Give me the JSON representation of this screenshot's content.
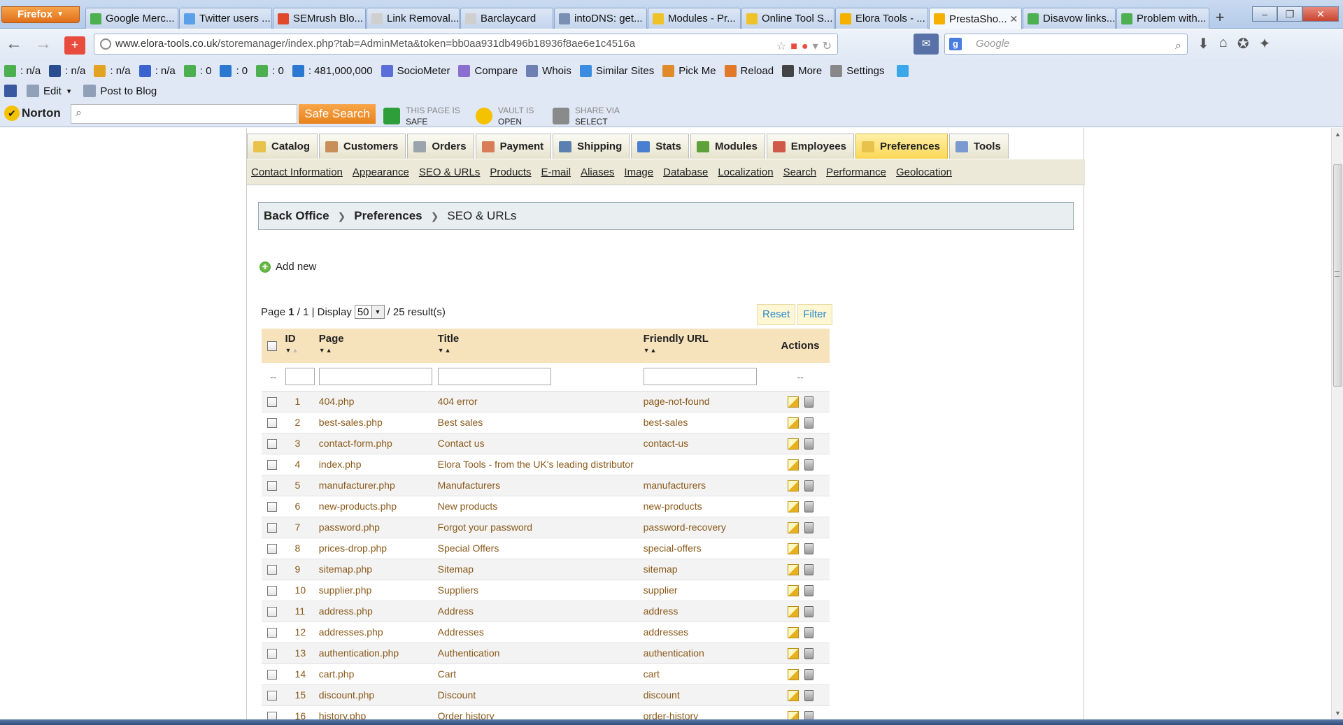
{
  "browser": {
    "app_button": "Firefox",
    "tabs": [
      {
        "label": "Google Merc...",
        "color": "#4caf50"
      },
      {
        "label": "Twitter users ...",
        "color": "#5aa0e8"
      },
      {
        "label": "SEMrush Blo...",
        "color": "#e04a2a"
      },
      {
        "label": "Link Removal...",
        "color": "#cfcfcf"
      },
      {
        "label": "Barclaycard",
        "color": "#cfcfcf"
      },
      {
        "label": "intoDNS: get...",
        "color": "#7a8fb4"
      },
      {
        "label": "Modules - Pr...",
        "color": "#f0c22a"
      },
      {
        "label": "Online Tool S...",
        "color": "#f0c22a"
      },
      {
        "label": "Elora Tools - ...",
        "color": "#f5b000"
      },
      {
        "label": "PrestaSho...",
        "color": "#f5b000",
        "active": true
      },
      {
        "label": "Disavow links...",
        "color": "#4caf50"
      },
      {
        "label": "Problem with...",
        "color": "#4caf50"
      }
    ],
    "new_tab": "+",
    "url_host": "www.elora-tools.co.uk",
    "url_path": "/storemanager/index.php?tab=AdminMeta&token=bb0aa931db496b18936f8ae6e1c4516a",
    "search_placeholder": "Google"
  },
  "seo_toolbar": {
    "items": [
      {
        "label": ": n/a",
        "color": "#4caf50"
      },
      {
        "label": ": n/a",
        "color": "#2a4d8f"
      },
      {
        "label": ": n/a",
        "color": "#e2a323"
      },
      {
        "label": ": n/a",
        "color": "#3a63d0"
      },
      {
        "label": ": 0",
        "color": "#4caf50"
      },
      {
        "label": ": 0",
        "color": "#2a78d0"
      },
      {
        "label": ": 0",
        "color": "#4caf50"
      },
      {
        "label": ": 481,000,000",
        "color": "#2a78d0"
      },
      {
        "label": "SocioMeter",
        "color": "#5b6ed8"
      },
      {
        "label": "Compare",
        "color": "#8a6fd0"
      },
      {
        "label": "Whois",
        "color": "#6d7fb3"
      },
      {
        "label": "Similar Sites",
        "color": "#3a8de0"
      },
      {
        "label": "Pick Me",
        "color": "#e08a2a"
      },
      {
        "label": "Reload",
        "color": "#e07a2a"
      },
      {
        "label": "More",
        "color": "#444444"
      },
      {
        "label": "Settings",
        "color": "#888888"
      }
    ]
  },
  "edit_toolbar": {
    "items": [
      {
        "label": "Edit",
        "color": "#8fa0b8"
      },
      {
        "label": "Post to Blog",
        "color": "#8fa0b8"
      }
    ]
  },
  "norton": {
    "logo": "Norton",
    "search_button": "Safe Search",
    "status": [
      {
        "top": "THIS PAGE IS",
        "bottom": "SAFE",
        "color": "#2e9e3a"
      },
      {
        "top": "VAULT IS",
        "bottom": "OPEN",
        "color": "#f5c200"
      },
      {
        "top": "SHARE VIA",
        "bottom": "SELECT",
        "color": "#8a8a8a"
      }
    ]
  },
  "admin": {
    "main_tabs": [
      {
        "label": "Catalog",
        "color": "#e8c24a"
      },
      {
        "label": "Customers",
        "color": "#c78f5a"
      },
      {
        "label": "Orders",
        "color": "#9aa4ac"
      },
      {
        "label": "Payment",
        "color": "#d77d5a"
      },
      {
        "label": "Shipping",
        "color": "#5a7fb0"
      },
      {
        "label": "Stats",
        "color": "#4a7fd0"
      },
      {
        "label": "Modules",
        "color": "#5ea03a"
      },
      {
        "label": "Employees",
        "color": "#d05a4a"
      },
      {
        "label": "Preferences",
        "color": "#e8c24a",
        "active": true
      },
      {
        "label": "Tools",
        "color": "#7a9ad0"
      }
    ],
    "sub_tabs": [
      "Contact Information",
      "Appearance",
      "SEO & URLs",
      "Products",
      "E-mail",
      "Aliases",
      "Image",
      "Database",
      "Localization",
      "Search",
      "Performance",
      "Geolocation"
    ],
    "breadcrumb": [
      "Back Office",
      "Preferences",
      "SEO & URLs"
    ],
    "add_new": "Add new",
    "pager": {
      "prefix": "Page",
      "current": "1",
      "sep": "/ 1 | Display",
      "per_page": "50",
      "results": "/ 25 result(s)"
    },
    "reset_label": "Reset",
    "filter_label": "Filter",
    "table": {
      "headers": {
        "id": "ID",
        "page": "Page",
        "title": "Title",
        "url": "Friendly URL",
        "actions": "Actions"
      },
      "filter_placeholder": "--",
      "rows": [
        {
          "id": "1",
          "page": "404.php",
          "title": "404 error",
          "url": "page-not-found"
        },
        {
          "id": "2",
          "page": "best-sales.php",
          "title": "Best sales",
          "url": "best-sales"
        },
        {
          "id": "3",
          "page": "contact-form.php",
          "title": "Contact us",
          "url": "contact-us"
        },
        {
          "id": "4",
          "page": "index.php",
          "title": "Elora Tools - from the UK's leading distributor",
          "url": ""
        },
        {
          "id": "5",
          "page": "manufacturer.php",
          "title": "Manufacturers",
          "url": "manufacturers"
        },
        {
          "id": "6",
          "page": "new-products.php",
          "title": "New products",
          "url": "new-products"
        },
        {
          "id": "7",
          "page": "password.php",
          "title": "Forgot your password",
          "url": "password-recovery"
        },
        {
          "id": "8",
          "page": "prices-drop.php",
          "title": "Special Offers",
          "url": "special-offers"
        },
        {
          "id": "9",
          "page": "sitemap.php",
          "title": "Sitemap",
          "url": "sitemap"
        },
        {
          "id": "10",
          "page": "supplier.php",
          "title": "Suppliers",
          "url": "supplier"
        },
        {
          "id": "11",
          "page": "address.php",
          "title": "Address",
          "url": "address"
        },
        {
          "id": "12",
          "page": "addresses.php",
          "title": "Addresses",
          "url": "addresses"
        },
        {
          "id": "13",
          "page": "authentication.php",
          "title": "Authentication",
          "url": "authentication"
        },
        {
          "id": "14",
          "page": "cart.php",
          "title": "Cart",
          "url": "cart"
        },
        {
          "id": "15",
          "page": "discount.php",
          "title": "Discount",
          "url": "discount"
        },
        {
          "id": "16",
          "page": "history.php",
          "title": "Order history",
          "url": "order-history"
        }
      ]
    }
  }
}
